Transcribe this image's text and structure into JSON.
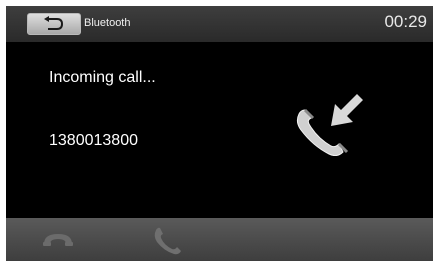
{
  "header": {
    "back_icon": "return-arrow-icon",
    "title": "Bluetooth",
    "clock": "00:29"
  },
  "call": {
    "status": "Incoming call...",
    "number": "1380013800",
    "status_icon": "incoming-call-icon"
  },
  "controls": {
    "hangup_icon": "hang-up-icon",
    "answer_icon": "answer-call-icon"
  },
  "colors": {
    "screen_bg": "#000000",
    "topbar": "#333333",
    "bottombar": "#4c4c4c",
    "icon_gray": "#6e6e6e"
  }
}
